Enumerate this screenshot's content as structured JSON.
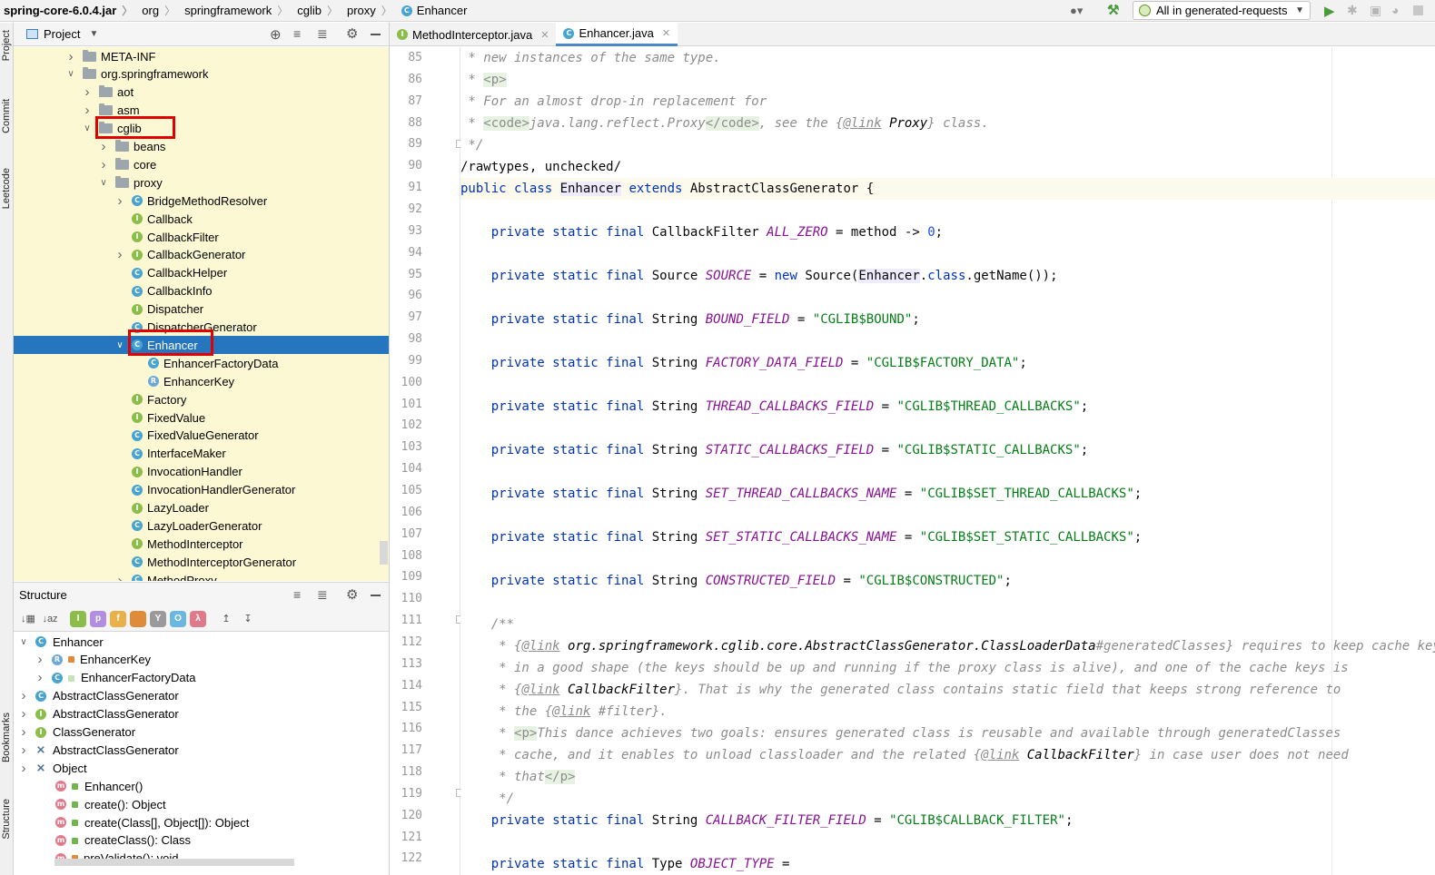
{
  "breadcrumb": [
    "spring-core-6.0.4.jar",
    "org",
    "springframework",
    "cglib",
    "proxy",
    "Enhancer"
  ],
  "run_config": "All in generated-requests",
  "side_tools": [
    "Project",
    "Commit",
    "Leetcode",
    "Bookmarks",
    "Structure"
  ],
  "project_panel": {
    "title": "Project"
  },
  "tree": [
    {
      "label": "META-INF",
      "kind": "folder",
      "depth": 0,
      "arrow": "right"
    },
    {
      "label": "org.springframework",
      "kind": "folder",
      "depth": 0,
      "arrow": "down"
    },
    {
      "label": "aot",
      "kind": "folder",
      "depth": 1,
      "arrow": "right"
    },
    {
      "label": "asm",
      "kind": "folder",
      "depth": 1,
      "arrow": "right"
    },
    {
      "label": "cglib",
      "kind": "folder",
      "depth": 1,
      "arrow": "down"
    },
    {
      "label": "beans",
      "kind": "folder",
      "depth": 2,
      "arrow": "right"
    },
    {
      "label": "core",
      "kind": "folder",
      "depth": 2,
      "arrow": "right"
    },
    {
      "label": "proxy",
      "kind": "folder",
      "depth": 2,
      "arrow": "down"
    },
    {
      "label": "BridgeMethodResolver",
      "kind": "class",
      "depth": 3,
      "arrow": "right"
    },
    {
      "label": "Callback",
      "kind": "interface",
      "depth": 3,
      "arrow": ""
    },
    {
      "label": "CallbackFilter",
      "kind": "interface",
      "depth": 3,
      "arrow": ""
    },
    {
      "label": "CallbackGenerator",
      "kind": "interface",
      "depth": 3,
      "arrow": "right"
    },
    {
      "label": "CallbackHelper",
      "kind": "class",
      "depth": 3,
      "arrow": ""
    },
    {
      "label": "CallbackInfo",
      "kind": "class",
      "depth": 3,
      "arrow": ""
    },
    {
      "label": "Dispatcher",
      "kind": "interface",
      "depth": 3,
      "arrow": ""
    },
    {
      "label": "DispatcherGenerator",
      "kind": "class",
      "depth": 3,
      "arrow": ""
    },
    {
      "label": "Enhancer",
      "kind": "class",
      "depth": 3,
      "arrow": "down",
      "selected": true
    },
    {
      "label": "EnhancerFactoryData",
      "kind": "class",
      "depth": 4,
      "arrow": ""
    },
    {
      "label": "EnhancerKey",
      "kind": "record",
      "depth": 4,
      "arrow": ""
    },
    {
      "label": "Factory",
      "kind": "interface",
      "depth": 3,
      "arrow": ""
    },
    {
      "label": "FixedValue",
      "kind": "interface",
      "depth": 3,
      "arrow": ""
    },
    {
      "label": "FixedValueGenerator",
      "kind": "class",
      "depth": 3,
      "arrow": ""
    },
    {
      "label": "InterfaceMaker",
      "kind": "class",
      "depth": 3,
      "arrow": ""
    },
    {
      "label": "InvocationHandler",
      "kind": "interface",
      "depth": 3,
      "arrow": ""
    },
    {
      "label": "InvocationHandlerGenerator",
      "kind": "class",
      "depth": 3,
      "arrow": ""
    },
    {
      "label": "LazyLoader",
      "kind": "interface",
      "depth": 3,
      "arrow": ""
    },
    {
      "label": "LazyLoaderGenerator",
      "kind": "class",
      "depth": 3,
      "arrow": ""
    },
    {
      "label": "MethodInterceptor",
      "kind": "interface",
      "depth": 3,
      "arrow": ""
    },
    {
      "label": "MethodInterceptorGenerator",
      "kind": "class",
      "depth": 3,
      "arrow": ""
    },
    {
      "label": "MethodProxy",
      "kind": "class",
      "depth": 3,
      "arrow": "right"
    }
  ],
  "structure_panel": {
    "title": "Structure"
  },
  "structure": [
    {
      "label": "Enhancer",
      "icon": "C",
      "depth": 0,
      "arrow": "down"
    },
    {
      "label": "EnhancerKey",
      "icon": "R",
      "depth": 1,
      "arrow": "right",
      "mod": "lock"
    },
    {
      "label": "EnhancerFactoryData",
      "icon": "C",
      "depth": 1,
      "arrow": "right",
      "mod": "pkg"
    },
    {
      "label": "AbstractClassGenerator",
      "icon": "C",
      "depth": 0,
      "arrow": "right"
    },
    {
      "label": "AbstractClassGenerator",
      "icon": "I",
      "depth": 0,
      "arrow": "right"
    },
    {
      "label": "ClassGenerator",
      "icon": "I",
      "depth": 0,
      "arrow": "right"
    },
    {
      "label": "AbstractClassGenerator",
      "icon": "H",
      "depth": 0,
      "arrow": "right"
    },
    {
      "label": "Object",
      "icon": "H",
      "depth": 0,
      "arrow": "right"
    },
    {
      "label": "Enhancer()",
      "icon": "m",
      "depth": 1,
      "arrow": "",
      "mod": "pub"
    },
    {
      "label": "create(): Object",
      "icon": "m",
      "depth": 1,
      "arrow": "",
      "mod": "pub"
    },
    {
      "label": "create(Class[], Object[]): Object",
      "icon": "m",
      "depth": 1,
      "arrow": "",
      "mod": "pub"
    },
    {
      "label": "createClass(): Class",
      "icon": "m",
      "depth": 1,
      "arrow": "",
      "mod": "pub"
    },
    {
      "label": "preValidate(): void",
      "icon": "m",
      "depth": 1,
      "arrow": "",
      "mod": "lock"
    }
  ],
  "tabs": [
    {
      "label": "MethodInterceptor.java",
      "icon": "I",
      "active": false
    },
    {
      "label": "Enhancer.java",
      "icon": "C",
      "active": true
    }
  ],
  "line_numbers": [
    "85",
    "86",
    "87",
    "88",
    "89",
    "90",
    "91",
    "92",
    "93",
    "94",
    "95",
    "96",
    "97",
    "98",
    "99",
    "100",
    "101",
    "102",
    "103",
    "104",
    "105",
    "106",
    "107",
    "108",
    "109",
    "110",
    "111",
    "112",
    "113",
    "114",
    "115",
    "116",
    "117",
    "118",
    "119",
    "120",
    "121",
    "122"
  ],
  "code": {
    "l85": " * new instances of the same type.",
    "l86_a": " * ",
    "l86_tag": "<p>",
    "l87": " * For an almost drop-in replacement for",
    "l88_a": " * ",
    "l88_t1": "<code>",
    "l88_b": "java.lang.reflect.Proxy",
    "l88_t2": "</code>",
    "l88_c": ", see the {",
    "l88_link": "@link",
    "l88_ref": " Proxy",
    "l88_d": "} class.",
    "l89": " */",
    "l90": "/rawtypes, unchecked/",
    "l91_kw1": "public class ",
    "l91_name": "Enhancer",
    "l91_kw2": " extends ",
    "l91_rest": "AbstractClassGenerator {",
    "pre": "private static final ",
    "l93_type": "CallbackFilter ",
    "l93_field": "ALL_ZERO",
    "l93_rest": " = method -> ",
    "l93_num": "0",
    "l93_end": ";",
    "l95_type": "Source ",
    "l95_field": "SOURCE",
    "l95_a": " = ",
    "l95_new": "new",
    "l95_b": " Source(",
    "l95_hl": "Enhancer",
    "l95_c": ".",
    "l95_cls": "class",
    "l95_d": ".getName());",
    "str_type": "String ",
    "l97_field": "BOUND_FIELD",
    "l97_val": "\"CGLIB$BOUND\"",
    "l99_field": "FACTORY_DATA_FIELD",
    "l99_val": "\"CGLIB$FACTORY_DATA\"",
    "l101_field": "THREAD_CALLBACKS_FIELD",
    "l101_val": "\"CGLIB$THREAD_CALLBACKS\"",
    "l103_field": "STATIC_CALLBACKS_FIELD",
    "l103_val": "\"CGLIB$STATIC_CALLBACKS\"",
    "l105_field": "SET_THREAD_CALLBACKS_NAME",
    "l105_val": "\"CGLIB$SET_THREAD_CALLBACKS\"",
    "l107_field": "SET_STATIC_CALLBACKS_NAME",
    "l107_val": "\"CGLIB$SET_STATIC_CALLBACKS\"",
    "l109_field": "CONSTRUCTED_FIELD",
    "l109_val": "\"CGLIB$CONSTRUCTED\"",
    "eq": " = ",
    "semi": ";",
    "l111": "/**",
    "l112_a": " * {",
    "l112_link": "@link",
    "l112_ref": " org.springframework.cglib.core.AbstractClassGenerator.ClassLoaderData",
    "l112_b": "#generatedClasses} requires to keep cache key",
    "l113": " * in a good shape (the keys should be up and running if the proxy class is alive), and one of the cache keys is",
    "l114_a": " * {",
    "l114_link": "@link",
    "l114_ref": " CallbackFilter",
    "l114_b": "}. That is why the generated class contains static field that keeps strong reference to",
    "l115_a": " * the {",
    "l115_link": "@link",
    "l115_b": " #filter}.",
    "l116_a": " * ",
    "l116_tag": "<p>",
    "l116_b": "This dance achieves two goals: ensures generated class is reusable and available through generatedClasses",
    "l117_a": " * cache, and it enables to unload classloader and the related {",
    "l117_link": "@link",
    "l117_ref": " CallbackFilter",
    "l117_b": "} in case user does not need",
    "l118_a": " * that",
    "l118_tag": "</p>",
    "l119": " */",
    "l120_field": "CALLBACK_FILTER_FIELD",
    "l120_val": "\"CGLIB$CALLBACK_FILTER\"",
    "l122_type": "Type ",
    "l122_field": "OBJECT_TYPE",
    "l122_rest": " ="
  }
}
